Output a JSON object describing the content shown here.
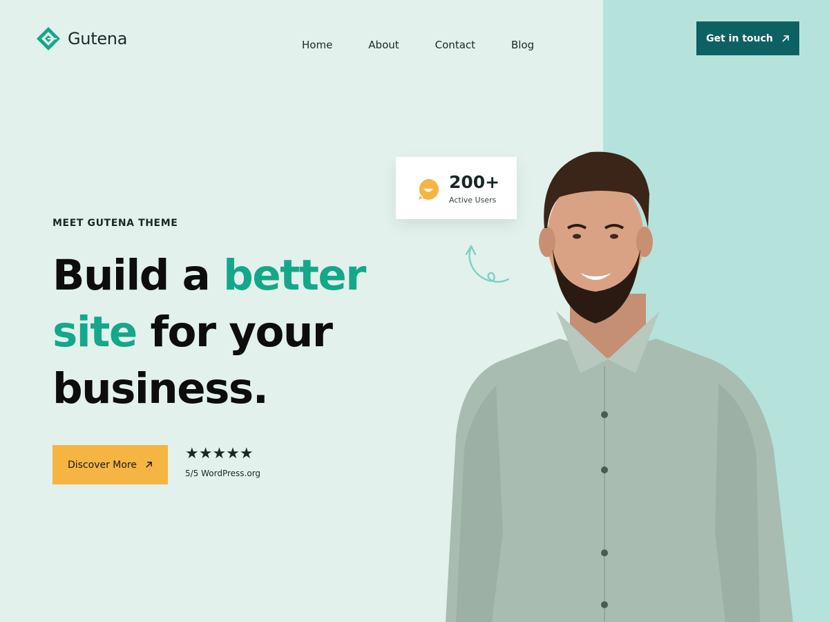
{
  "header": {
    "logo_text": "Gutena",
    "logo_icon": "gutena-diamond-icon",
    "nav": [
      {
        "label": "Home"
      },
      {
        "label": "About"
      },
      {
        "label": "Contact"
      },
      {
        "label": "Blog"
      }
    ],
    "cta_label": "Get in touch"
  },
  "hero": {
    "eyebrow": "MEET GUTENA THEME",
    "headline_1": "Build a",
    "headline_2": "better",
    "headline_3": "site",
    "headline_4": "for your",
    "headline_5": "business.",
    "button_label": "Discover More",
    "stars": "★★★★★",
    "rating_text": "5/5 WordPress.org"
  },
  "card": {
    "number": "200+",
    "label": "Active Users",
    "icon": "smile-chat-icon"
  },
  "colors": {
    "background": "#e2f1ec",
    "panel": "#b5e3dc",
    "accent_green": "#15a78a",
    "cta_teal": "#0e6163",
    "button_yellow": "#f5b542"
  }
}
